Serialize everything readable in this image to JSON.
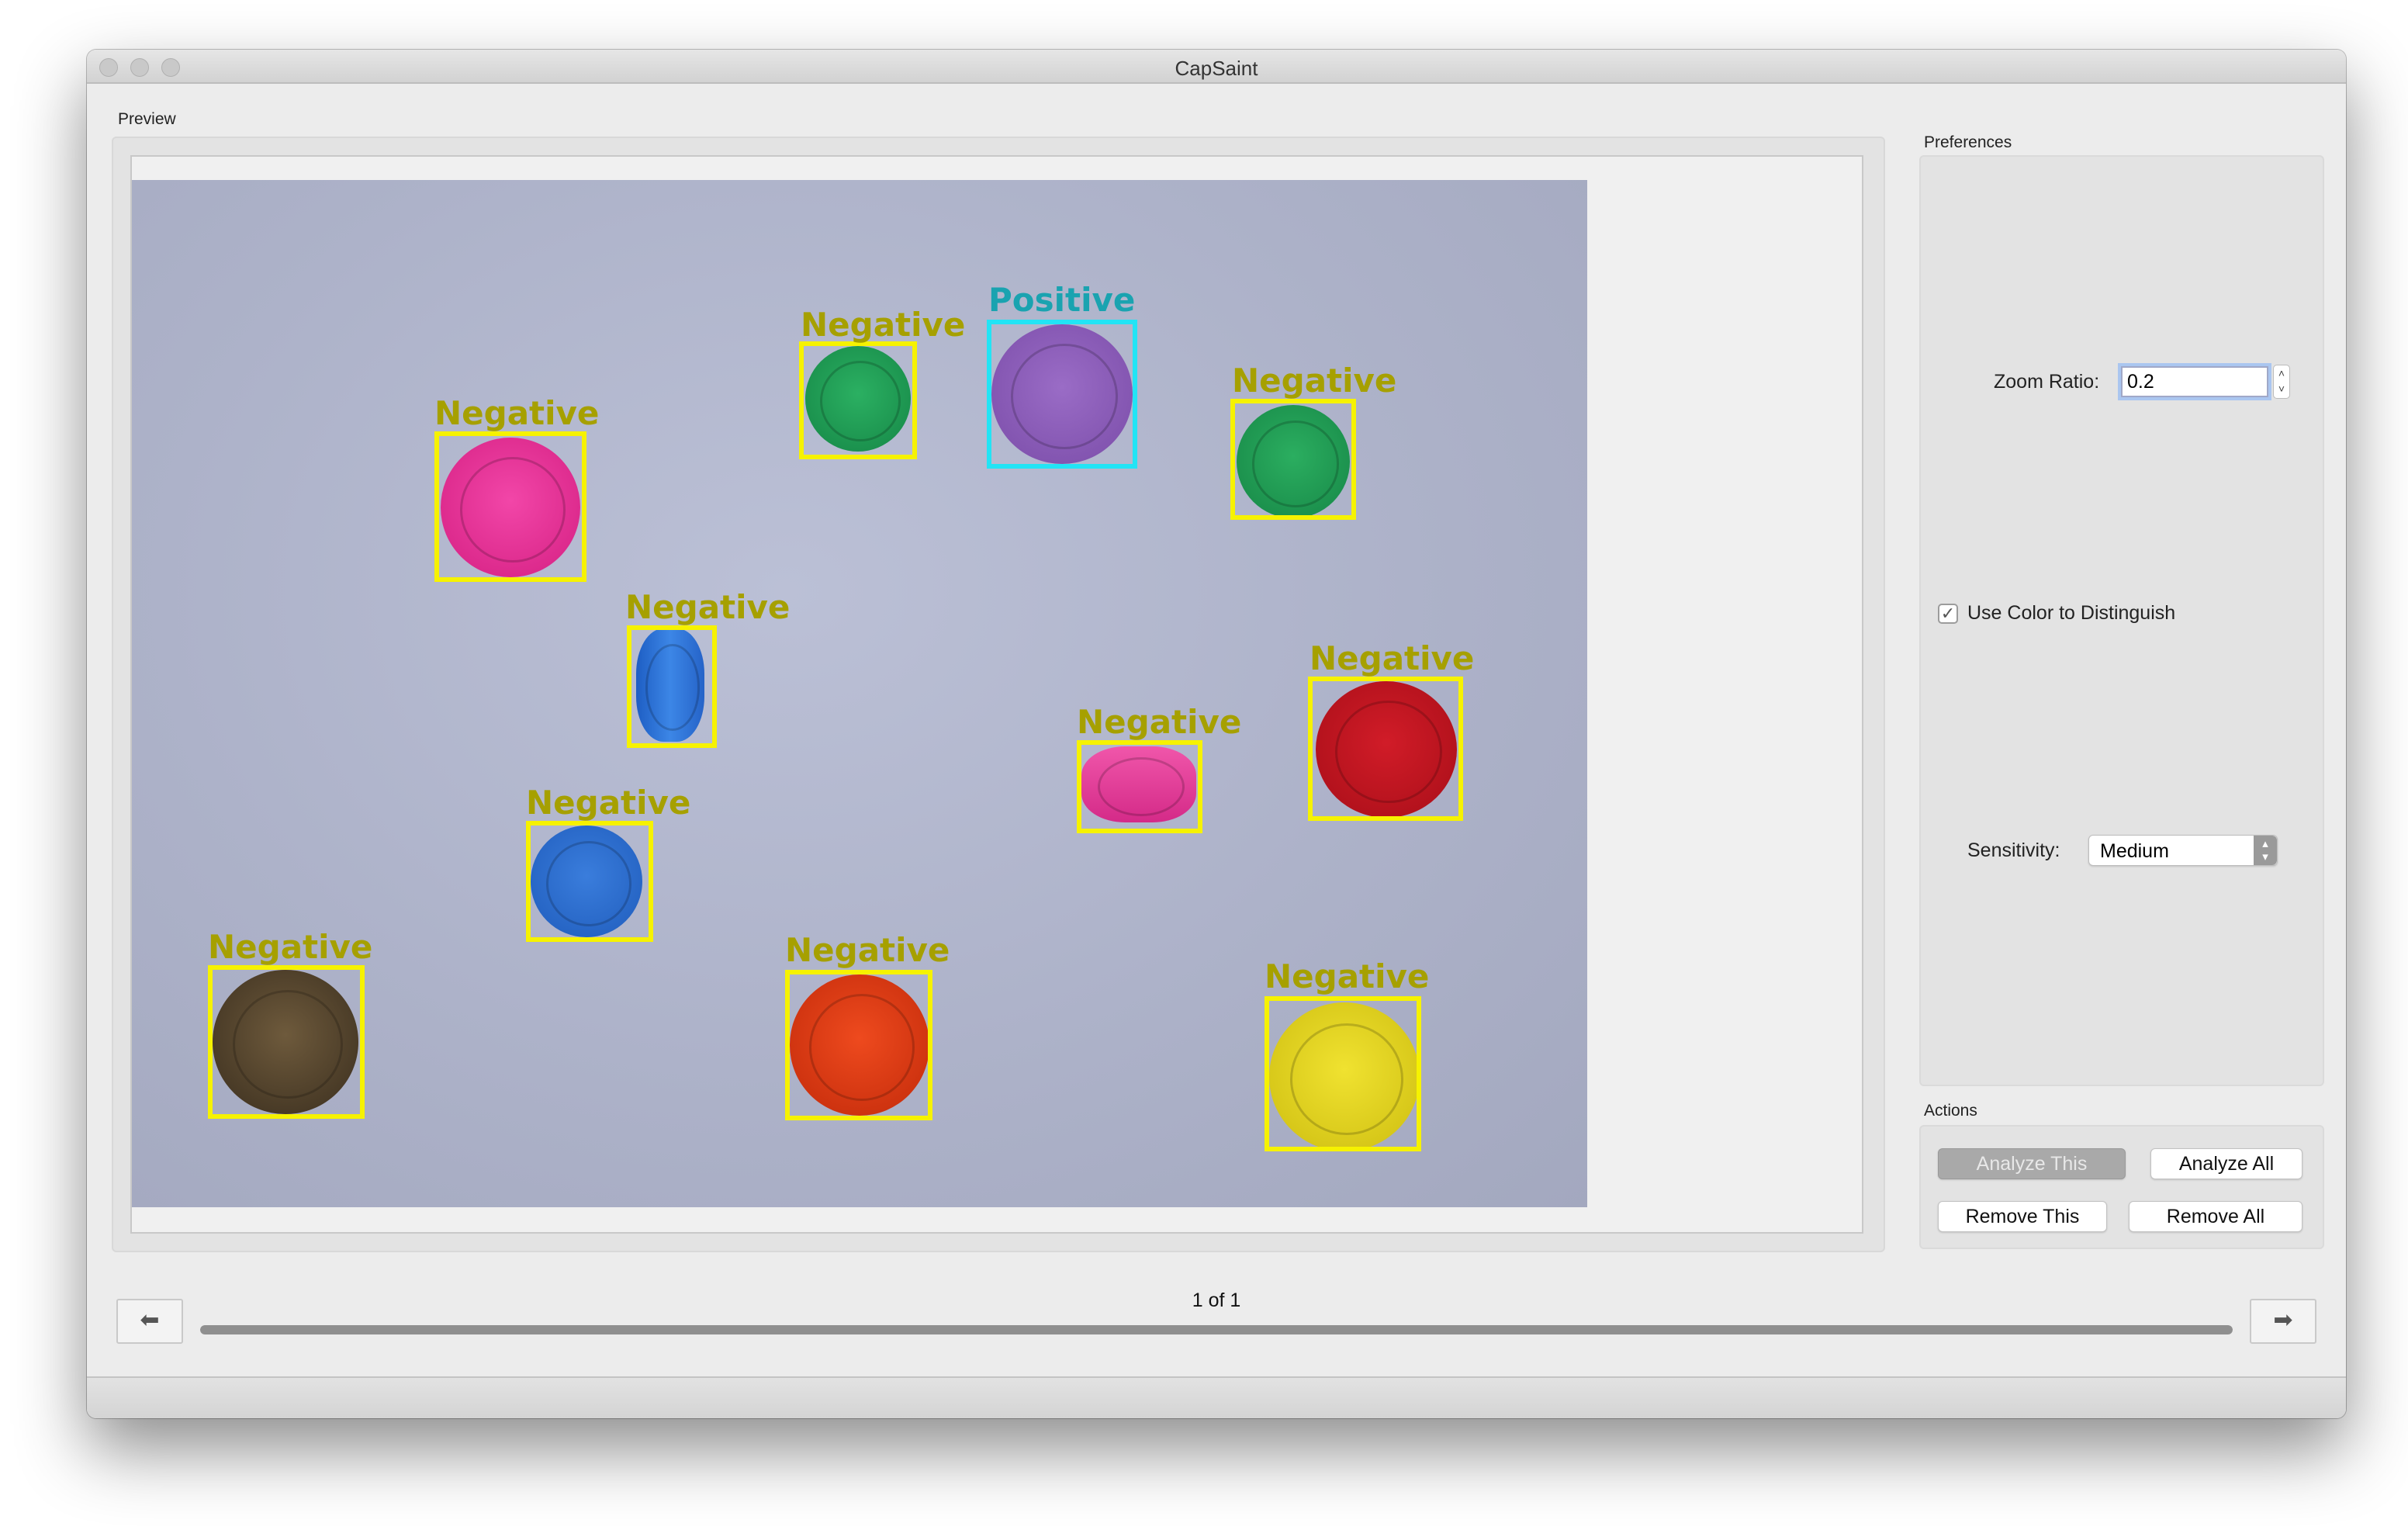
{
  "window": {
    "title": "CapSaint"
  },
  "preview": {
    "group_label": "Preview"
  },
  "detections": [
    {
      "label": "Negative",
      "result": "negative",
      "cap_color": "#e8339a"
    },
    {
      "label": "Negative",
      "result": "negative",
      "cap_color": "#1e9a52"
    },
    {
      "label": "Positive",
      "result": "positive",
      "cap_color": "#8a5ab8"
    },
    {
      "label": "Negative",
      "result": "negative",
      "cap_color": "#1f9c52"
    },
    {
      "label": "Negative",
      "result": "negative",
      "cap_color": "#2d74d6"
    },
    {
      "label": "Negative",
      "result": "negative",
      "cap_color": "#e83e9c"
    },
    {
      "label": "Negative",
      "result": "negative",
      "cap_color": "#c4121e"
    },
    {
      "label": "Negative",
      "result": "negative",
      "cap_color": "#2a6fd2"
    },
    {
      "label": "Negative",
      "result": "negative",
      "cap_color": "#4a3a26"
    },
    {
      "label": "Negative",
      "result": "negative",
      "cap_color": "#e23a12"
    },
    {
      "label": "Negative",
      "result": "negative",
      "cap_color": "#e6d61a"
    }
  ],
  "preferences": {
    "group_label": "Preferences",
    "zoom_label": "Zoom Ratio:",
    "zoom_value": "0.2",
    "color_checkbox_label": "Use Color to Distinguish",
    "color_checked": true,
    "sensitivity_label": "Sensitivity:",
    "sensitivity_value": "Medium"
  },
  "actions": {
    "group_label": "Actions",
    "analyze_this": "Analyze This",
    "analyze_all": "Analyze All",
    "remove_this": "Remove This",
    "remove_all": "Remove All"
  },
  "navigation": {
    "page_text": "1 of 1",
    "progress": 1.0,
    "prev_icon": "arrow-left-icon",
    "next_icon": "arrow-right-icon"
  },
  "colors": {
    "negative_box": "#f6f200",
    "positive_box": "#22e4f5",
    "negative_text": "#a6a000",
    "positive_text": "#1aa3b0"
  }
}
